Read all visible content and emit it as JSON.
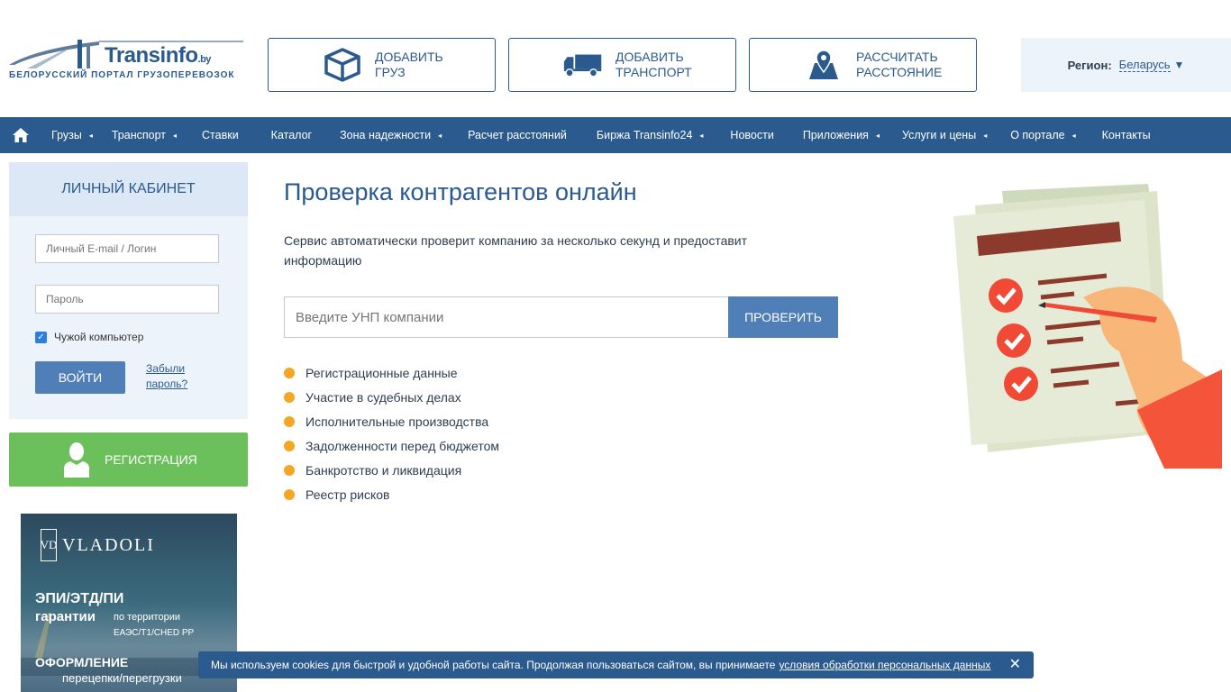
{
  "header": {
    "logo": {
      "brand": "Transinfo",
      "domain": ".by",
      "subtitle": "БЕЛОРУССКИЙ ПОРТАЛ ГРУЗОПЕРЕВОЗОК"
    },
    "buttons": [
      {
        "line1": "ДОБАВИТЬ",
        "line2": "ГРУЗ",
        "icon": "box-icon"
      },
      {
        "line1": "ДОБАВИТЬ",
        "line2": "ТРАНСПОРТ",
        "icon": "truck-icon"
      },
      {
        "line1": "РАССЧИТАТЬ",
        "line2": "РАССТОЯНИЕ",
        "icon": "map-pin-icon"
      }
    ],
    "region": {
      "label": "Регион:",
      "value": "Беларусь",
      "arrow": "▼"
    }
  },
  "nav": {
    "items": [
      {
        "label": "Грузы",
        "caret": "◂"
      },
      {
        "label": "Транспорт",
        "caret": "◂"
      },
      {
        "label": "Ставки",
        "caret": ""
      },
      {
        "label": "Каталог",
        "caret": ""
      },
      {
        "label": "Зона надежности",
        "caret": "◂"
      },
      {
        "label": "Расчет расстояний",
        "caret": ""
      },
      {
        "label": "Биржа Transinfo24",
        "caret": "◂"
      },
      {
        "label": "Новости",
        "caret": ""
      },
      {
        "label": "Приложения",
        "caret": "◂"
      },
      {
        "label": "Услуги и цены",
        "caret": "◂"
      },
      {
        "label": "О портале",
        "caret": "◂"
      },
      {
        "label": "Контакты",
        "caret": ""
      }
    ]
  },
  "sidebar": {
    "cabinet_title": "ЛИЧНЫЙ КАБИНЕТ",
    "login_placeholder": "Личный E-mail / Логин",
    "password_placeholder": "Пароль",
    "checkbox_label": "Чужой компьютер",
    "checkbox_mark": "✓",
    "login_button": "ВОЙТИ",
    "forgot_line1": "Забыли",
    "forgot_line2": "пароль?",
    "register_button": "РЕГИСТРАЦИЯ"
  },
  "ad": {
    "brand": "VLADOLI",
    "monogram": "VD",
    "line1": "ЭПИ/ЭТД/ПИ",
    "line2": "гарантии",
    "line2_side": "по территории",
    "line3": "ЕАЭС/Т1/CHED PP",
    "line4": "ОФОРМЛЕНИЕ",
    "line5": "перецепки/перегрузки"
  },
  "main": {
    "title": "Проверка контрагентов онлайн",
    "description": "Сервис автоматически проверит компанию за несколько секунд и предоставит информацию",
    "search_placeholder": "Введите УНП компании",
    "search_button": "ПРОВЕРИТЬ",
    "features": [
      "Регистрационные данные",
      "Участие в судебных делах",
      "Исполнительные производства",
      "Задолженности перед бюджетом",
      "Банкротство и ликвидация",
      "Реестр рисков"
    ]
  },
  "cookie": {
    "text": "Мы используем cookies для быстрой и удобной работы сайта. Продолжая пользоваться сайтом, вы принимаете",
    "link": "условия обработки персональных данных",
    "close": "✕"
  },
  "colors": {
    "brand_blue": "#2b5a8f",
    "button_blue": "#4f7fb6",
    "register_green": "#6cc05b",
    "bullet_orange": "#f5a623"
  }
}
